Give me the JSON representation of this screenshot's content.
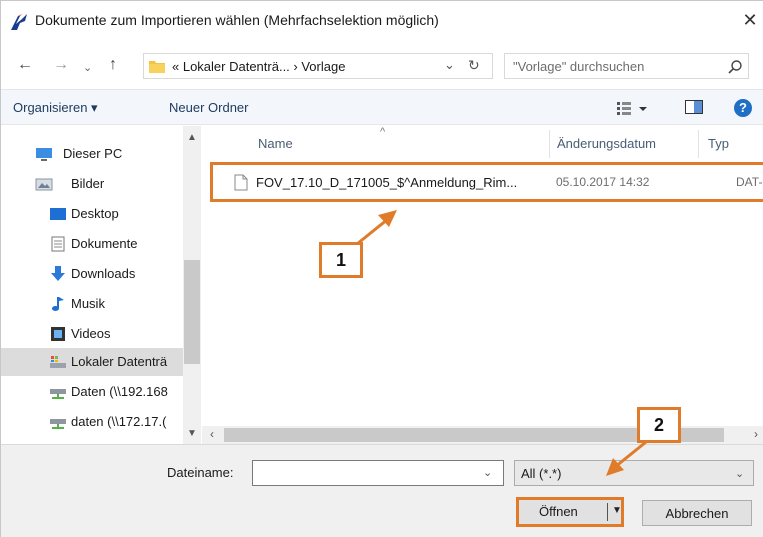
{
  "window": {
    "title": "Dokumente zum Importieren wählen (Mehrfachselektion möglich)",
    "close_glyph": "✕"
  },
  "nav": {
    "back": "←",
    "forward": "→",
    "recent": "⌄",
    "up": "↑",
    "address": "« Lokaler Datenträ... › Vorlage",
    "address_dropdown": "⌄",
    "refresh": "↻",
    "search_placeholder": "\"Vorlage\" durchsuchen"
  },
  "toolbar": {
    "organize": "Organisieren ▾",
    "new_folder": "Neuer Ordner",
    "help": "?"
  },
  "sidebar": {
    "items": [
      {
        "label": "Dieser PC",
        "icon": "computer-icon"
      },
      {
        "label": "Bilder",
        "icon": "pictures-icon"
      },
      {
        "label": "Desktop",
        "icon": "desktop-icon"
      },
      {
        "label": "Dokumente",
        "icon": "documents-icon"
      },
      {
        "label": "Downloads",
        "icon": "download-icon"
      },
      {
        "label": "Musik",
        "icon": "music-icon"
      },
      {
        "label": "Videos",
        "icon": "video-icon"
      },
      {
        "label": "Lokaler Datenträ",
        "icon": "drive-icon"
      },
      {
        "label": "Daten (\\\\192.168",
        "icon": "network-drive-icon"
      },
      {
        "label": "daten (\\\\172.17.(",
        "icon": "network-drive-icon"
      }
    ],
    "selected_index": 7
  },
  "filelist": {
    "columns": [
      "Name",
      "Änderungsdatum",
      "Typ"
    ],
    "rows": [
      {
        "name": "FOV_17.10_D_171005_$^Anmeldung_Rim...",
        "date": "05.10.2017 14:32",
        "type": "DAT-Dat"
      }
    ]
  },
  "bottom": {
    "filename_label": "Dateiname:",
    "filename_value": "",
    "filetype": "All (*.*)",
    "open_label": "Öffnen",
    "cancel_label": "Abbrechen"
  },
  "annotations": {
    "callout_1": "1",
    "callout_2": "2",
    "accent_color": "#e07b2a"
  }
}
